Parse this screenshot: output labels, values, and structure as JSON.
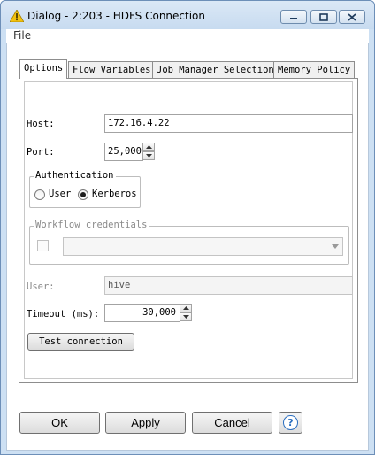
{
  "window": {
    "title": "Dialog - 2:203 - HDFS Connection",
    "accent": "#cde0f3"
  },
  "menu": {
    "file": "File"
  },
  "tabs": [
    {
      "label": "Options",
      "active": true
    },
    {
      "label": "Flow Variables",
      "active": false
    },
    {
      "label": "Job Manager Selection",
      "active": false
    },
    {
      "label": "Memory Policy",
      "active": false
    }
  ],
  "form": {
    "host_label": "Host:",
    "host_value": "172.16.4.22",
    "port_label": "Port:",
    "port_value": "25,000",
    "auth_title": "Authentication",
    "auth_user": "User",
    "auth_kerberos": "Kerberos",
    "auth_selected": "Kerberos",
    "workflow_title": "Workflow credentials",
    "workflow_value": "",
    "user_label": "User:",
    "user_value": "hive",
    "timeout_label": "Timeout (ms):",
    "timeout_value": "30,000",
    "test_button": "Test connection"
  },
  "footer": {
    "ok": "OK",
    "apply": "Apply",
    "cancel": "Cancel",
    "help": "?"
  },
  "icons": {
    "title": "warning-triangle-icon",
    "minimize": "minimize-icon",
    "maximize": "maximize-icon",
    "close": "close-icon",
    "help": "help-icon"
  }
}
